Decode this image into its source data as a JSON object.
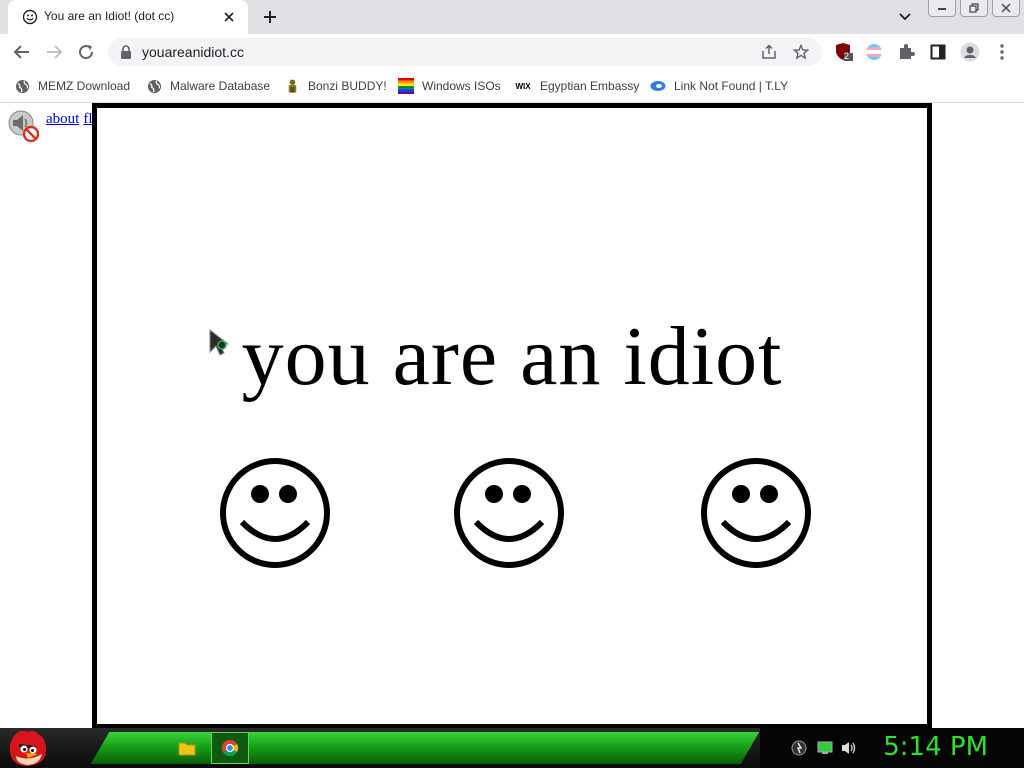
{
  "browser": {
    "tab": {
      "title": "You are an Idiot! (dot cc)",
      "close_symbol": "✕",
      "favicon": "smiley-icon"
    },
    "new_tab_symbol": "+",
    "tab_search_symbol": "⌄",
    "window_controls": {
      "minimize_symbol": "—",
      "restore_symbol": "❐",
      "close_symbol": "✕"
    },
    "toolbar": {
      "url": "youareanidiot.cc",
      "extension_badge": "2"
    },
    "bookmarks": [
      {
        "label": "MEMZ Download",
        "icon": "globe-icon"
      },
      {
        "label": "Malware Database",
        "icon": "globe-icon"
      },
      {
        "label": "Bonzi BUDDY!",
        "icon": "bonzi-icon"
      },
      {
        "label": "Windows ISOs",
        "icon": "windows-flag-icon"
      },
      {
        "label": "Egyptian Embassy",
        "icon": "wix-icon",
        "icon_text": "WIX"
      },
      {
        "label": "Link Not Found | T.LY",
        "icon": "tly-icon"
      }
    ]
  },
  "page": {
    "links": {
      "about": "about",
      "flash": "flash"
    },
    "headline": "you are an idiot",
    "smiley_count": 3
  },
  "taskbar": {
    "clock": "5:14 PM",
    "accent_color": "#2ee02e"
  }
}
